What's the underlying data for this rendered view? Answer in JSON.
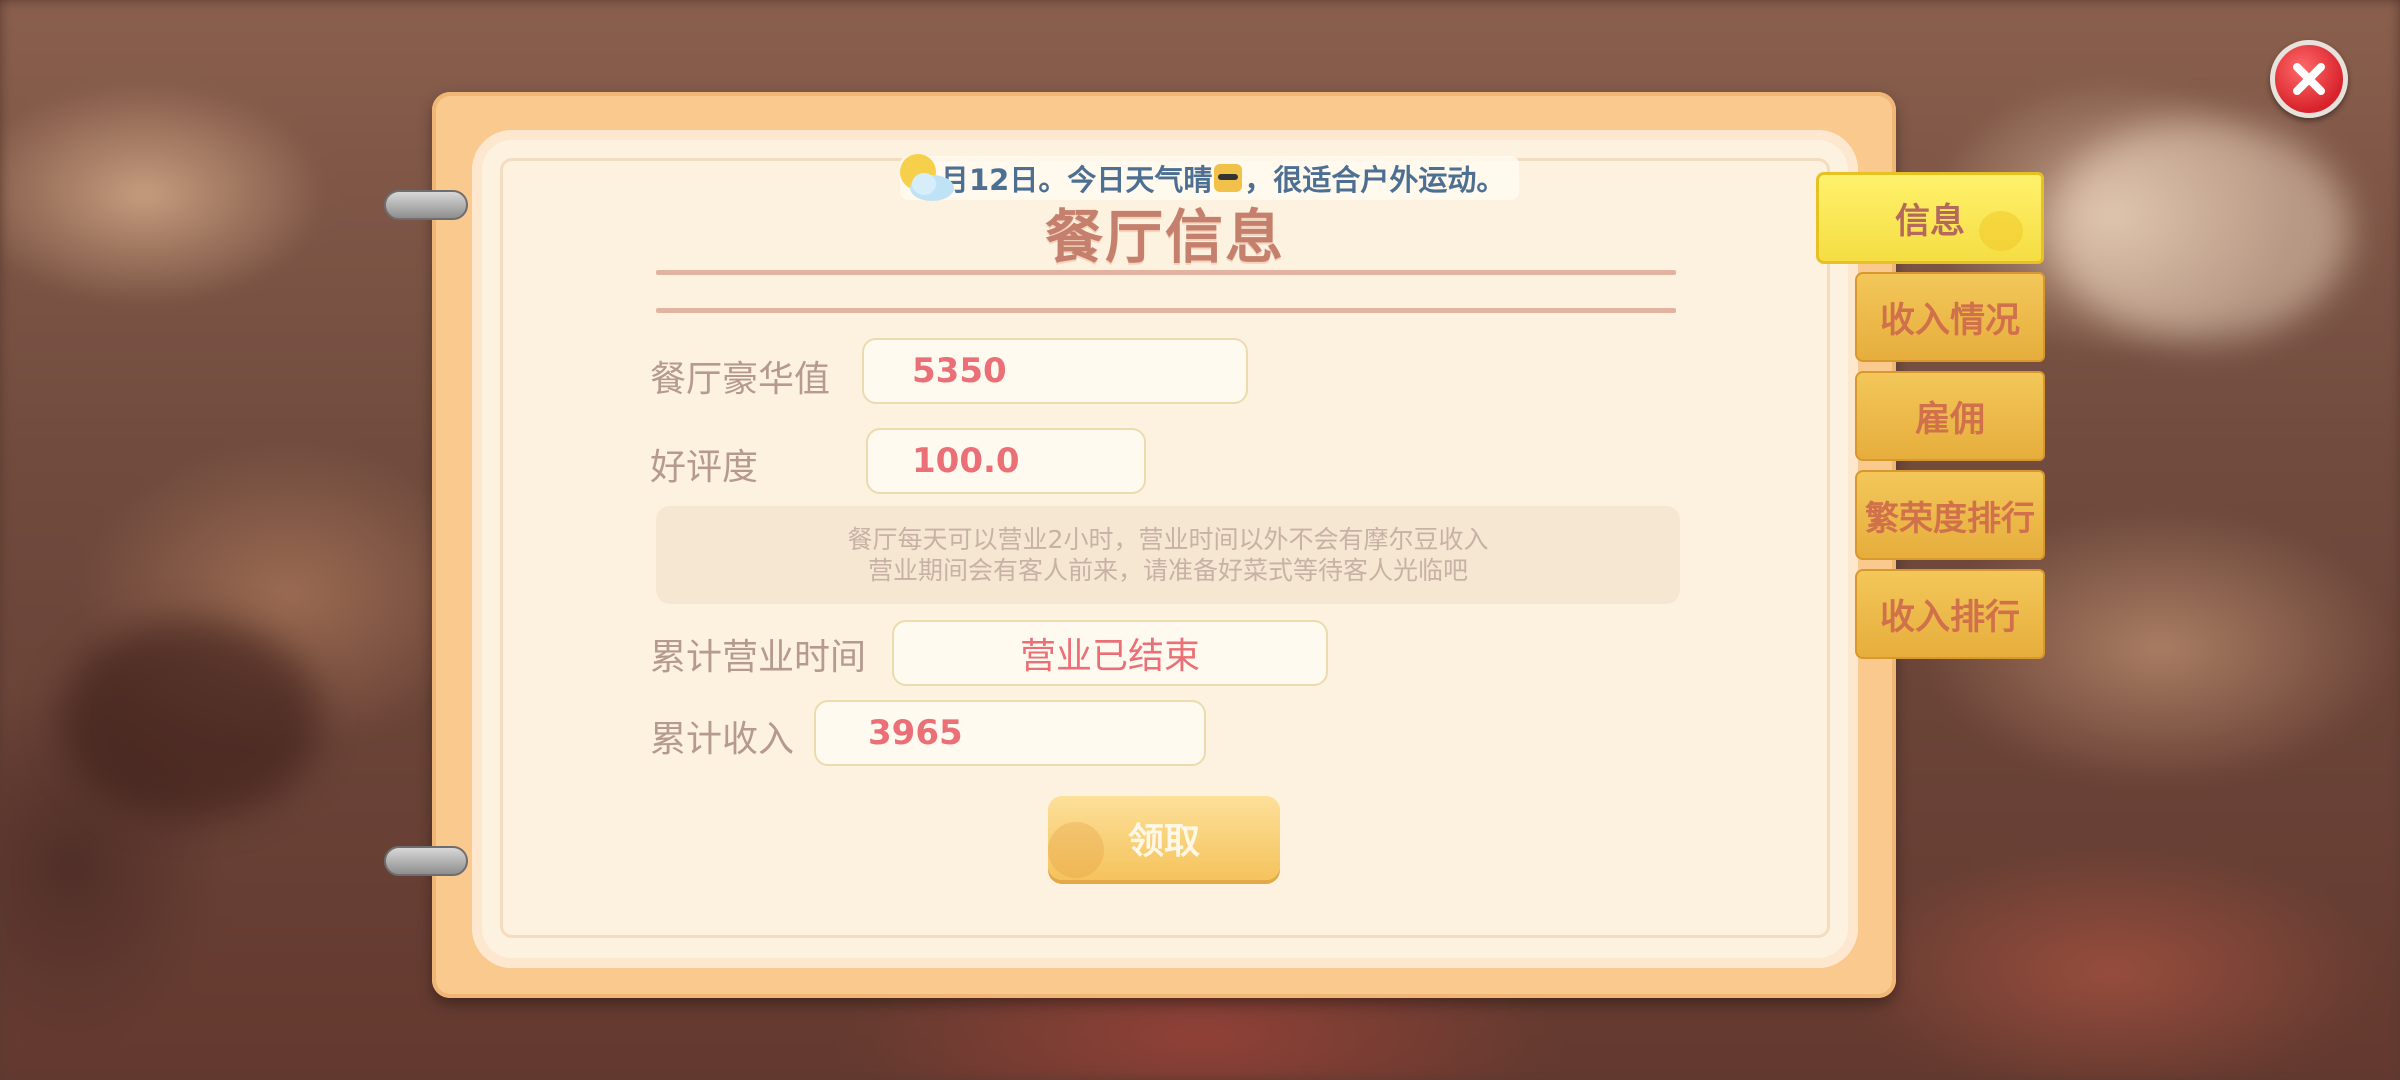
{
  "ticker": {
    "text_before": "月12日。今日天气晴",
    "text_after": "，很适合户外运动。",
    "weather_icon": "sun-cloud-icon",
    "emoji_icon": "sunglasses-emoji-icon"
  },
  "panel": {
    "title": "餐厅信息",
    "luxury_label": "餐厅豪华值",
    "luxury_value": "5350",
    "rating_label": "好评度",
    "rating_value": "100.0",
    "notice_line1": "餐厅每天可以营业2小时，营业时间以外不会有摩尔豆收入",
    "notice_line2": "营业期间会有客人前来，请准备好菜式等待客人光临吧",
    "hours_label": "累计营业时间",
    "hours_value": "营业已结束",
    "income_label": "累计收入",
    "income_value": "3965",
    "claim_button": "领取"
  },
  "tabs": [
    {
      "label": "信息",
      "active": true
    },
    {
      "label": "收入情况",
      "active": false
    },
    {
      "label": "雇佣",
      "active": false
    },
    {
      "label": "繁荣度排行",
      "active": false
    },
    {
      "label": "收入排行",
      "active": false
    }
  ],
  "close_icon": "close-x-icon",
  "colors": {
    "accent_red": "#ea6f76",
    "tab_yellow": "#f3c75a",
    "active_tab": "#f5dd43",
    "book_orange": "#f9c98d",
    "close_red": "#d8232b"
  }
}
